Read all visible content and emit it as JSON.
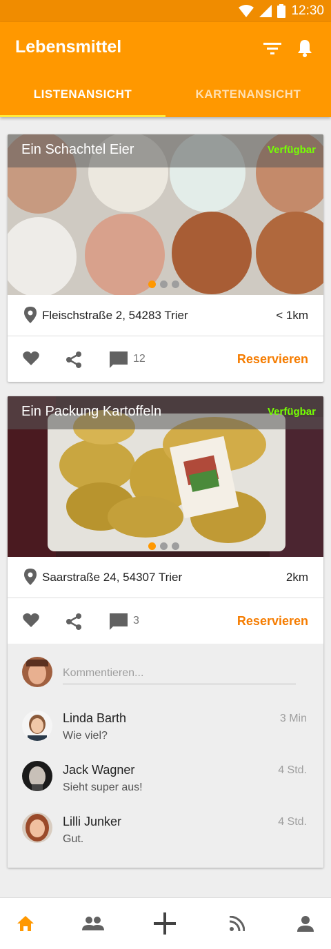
{
  "status_bar": {
    "time": "12:30",
    "icons": [
      "wifi-icon",
      "signal-icon",
      "battery-icon"
    ]
  },
  "app_bar": {
    "title": "Lebensmittel",
    "icons": [
      "filter-icon",
      "bell-icon"
    ]
  },
  "tabs": [
    {
      "label": "LISTENANSICHT",
      "active": true
    },
    {
      "label": "KARTENANSICHT",
      "active": false
    }
  ],
  "cards": [
    {
      "title": "Ein Schachtel Eier",
      "availability": "Verfügbar",
      "image": "egg-carton-photo",
      "address": "Fleischstraße 2, 54283 Trier",
      "distance": "< 1km",
      "comment_count": "12",
      "reserve_label": "Reservieren"
    },
    {
      "title": "Ein Packung Kartoffeln",
      "availability": "Verfügbar",
      "image": "potatoes-photo",
      "address": "Saarstraße 24, 54307 Trier",
      "distance": "2km",
      "comment_count": "3",
      "reserve_label": "Reservieren",
      "comment_placeholder": "Kommentieren...",
      "comments": [
        {
          "name": "Linda Barth",
          "text": "Wie viel?",
          "time": "3 Min"
        },
        {
          "name": "Jack Wagner",
          "text": "Sieht super aus!",
          "time": "4 Std."
        },
        {
          "name": "Lilli Junker",
          "text": "Gut.",
          "time": "4 Std."
        }
      ]
    }
  ],
  "bottom_nav": [
    "home-icon",
    "group-icon",
    "add-icon",
    "feed-icon",
    "profile-icon"
  ],
  "colors": {
    "primary": "#ff9800",
    "status_bar": "#f08c00",
    "accent": "#f57c00",
    "available": "#76ff03",
    "tab_indicator": "#ffeb3b"
  }
}
